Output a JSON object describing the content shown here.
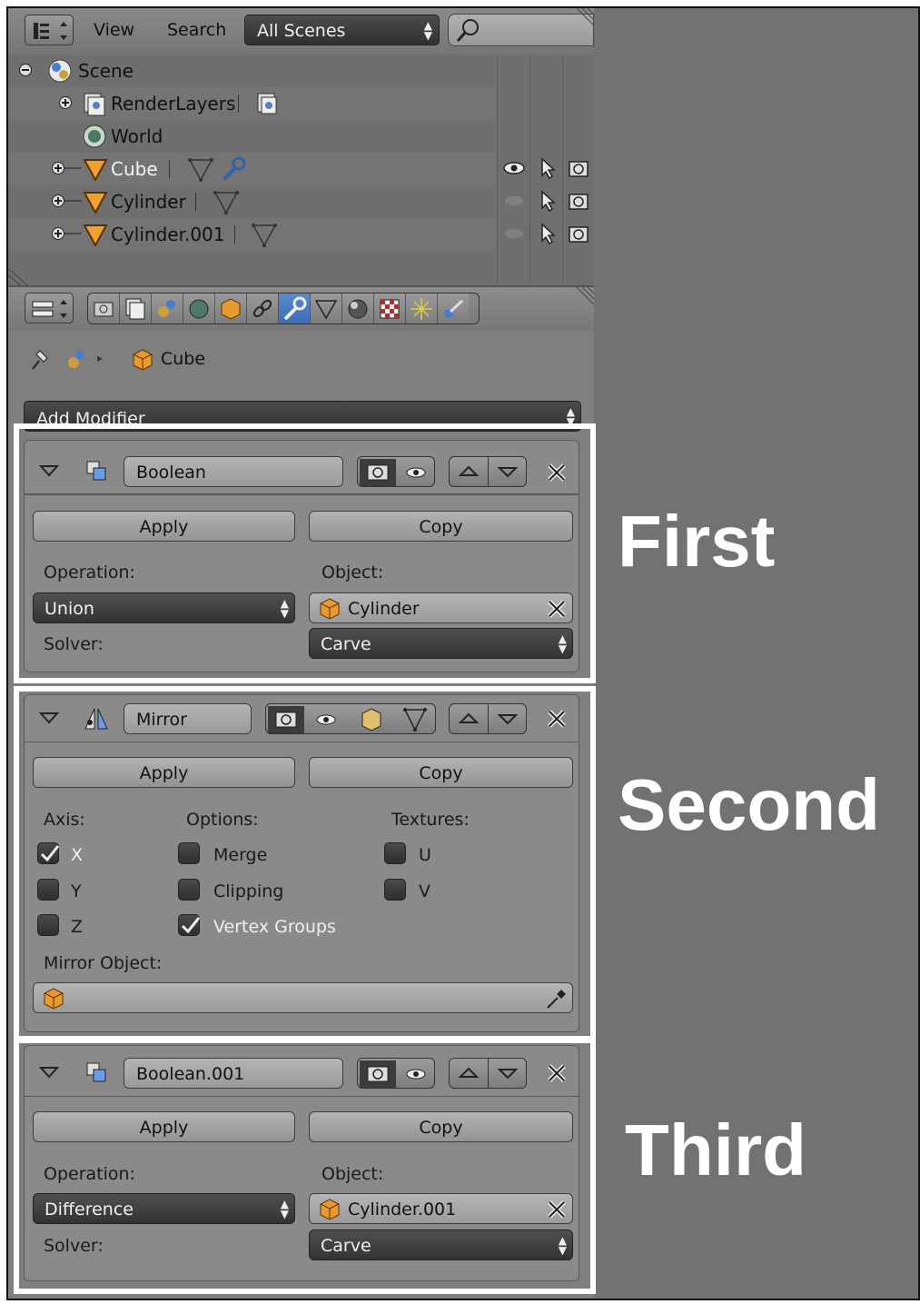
{
  "outliner": {
    "menu_view": "View",
    "menu_search": "Search",
    "scenes_dropdown": "All Scenes",
    "items": [
      {
        "name": "Scene"
      },
      {
        "name": "RenderLayers"
      },
      {
        "name": "World"
      },
      {
        "name": "Cube"
      },
      {
        "name": "Cylinder"
      },
      {
        "name": "Cylinder.001"
      }
    ]
  },
  "properties": {
    "context_object": "Cube",
    "add_modifier": "Add Modifier",
    "modifiers": [
      {
        "name": "Boolean",
        "apply": "Apply",
        "copy": "Copy",
        "operation_label": "Operation:",
        "operation": "Union",
        "object_label": "Object:",
        "object": "Cylinder",
        "solver_label": "Solver:",
        "solver": "Carve"
      },
      {
        "name": "Mirror",
        "apply": "Apply",
        "copy": "Copy",
        "axis_label": "Axis:",
        "options_label": "Options:",
        "textures_label": "Textures:",
        "axis": [
          {
            "label": "X",
            "checked": true
          },
          {
            "label": "Y",
            "checked": false
          },
          {
            "label": "Z",
            "checked": false
          }
        ],
        "options": [
          {
            "label": "Merge",
            "checked": false
          },
          {
            "label": "Clipping",
            "checked": false
          },
          {
            "label": "Vertex Groups",
            "checked": true
          }
        ],
        "textures": [
          {
            "label": "U",
            "checked": false
          },
          {
            "label": "V",
            "checked": false
          }
        ],
        "mirror_object_label": "Mirror Object:"
      },
      {
        "name": "Boolean.001",
        "apply": "Apply",
        "copy": "Copy",
        "operation_label": "Operation:",
        "operation": "Difference",
        "object_label": "Object:",
        "object": "Cylinder.001",
        "solver_label": "Solver:",
        "solver": "Carve"
      }
    ]
  },
  "annotations": {
    "first": "First",
    "second": "Second",
    "third": "Third"
  },
  "colors": {
    "panel_bg": "#8a8a8a",
    "window_bg": "#727272",
    "highlight": "#ffffff",
    "selected_text": "#f3f3f3"
  }
}
